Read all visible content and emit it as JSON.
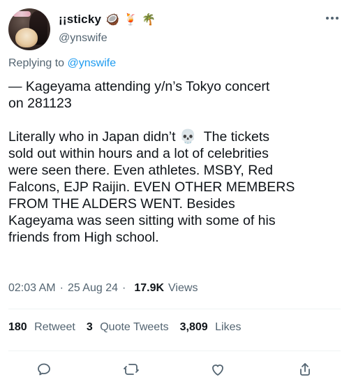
{
  "tweet": {
    "author": {
      "display_name": "¡¡sticky",
      "name_emojis": [
        "🥥",
        "🍹",
        "🌴"
      ],
      "handle": "@ynswife"
    },
    "replying_to_prefix": "Replying to",
    "replying_to_handle": "@ynswife",
    "text_line_1": "— Kageyama attending y/n’s Tokyo concert",
    "text_line_2": "on 281123",
    "text_body": "Literally who in Japan didn’t 💀  The tickets\nsold out within hours and a lot of celebrities\nwere seen there. Even athletes. MSBY, Red\nFalcons, EJP Raijin. EVEN OTHER MEMBERS\nFROM THE ALDERS WENT. Besides\nKageyama was seen sitting with some of his\nfriends from High school.",
    "time": "02:03 AM",
    "date": "25 Aug 24",
    "views_count": "17.9K",
    "views_label": "Views",
    "stats": {
      "retweets_count": "180",
      "retweets_label": "Retweet",
      "quotes_count": "3",
      "quotes_label": "Quote Tweets",
      "likes_count": "3,809",
      "likes_label": "Likes"
    }
  },
  "icons": {
    "more": "more-dots-icon",
    "reply": "reply-icon",
    "retweet": "retweet-icon",
    "like": "heart-icon",
    "share": "share-icon"
  },
  "colors": {
    "text": "#0f1419",
    "muted": "#536471",
    "link": "#1d9bf0",
    "divider": "#eff3f4"
  }
}
